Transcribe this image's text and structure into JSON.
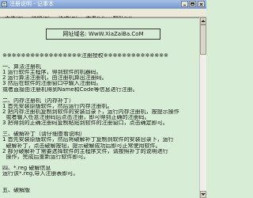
{
  "window": {
    "title": "注册说明 - 记事本",
    "app_icon": "notepad-icon",
    "controls": [
      "minimize-icon",
      "maximize-icon",
      "close-icon"
    ]
  },
  "menu": [
    "文件(F)",
    "编辑(E)",
    "格式(O)",
    "查看(V)",
    "帮助(H)"
  ],
  "document": {
    "banner": "网址域名: WwW.XiaZaiBa.CoM",
    "divider": "※※※※※※※※※※※※※※※※※注册授权※※※※※※※※※※※※※※",
    "sections": [
      {
        "heading": "一、算法注册机",
        "lines": [
          "1 运行软件主程序，得到软件的机器码。",
          "2 运行算法注册机，由注册机算出注册码。",
          "3 然后在软件的注册窗口中输入注册码。",
          "或者直接由注册机得到Name和Code等信息进行注册。"
        ]
      },
      {
        "heading": "二、内存注册机（内存补丁）",
        "lines": [
          "1 首先安装原版软件，然后运行内存注册机。",
          "2 把内存注册机复制到软件的安装目录下，运行内存注册机，按提示操作",
          "  或者输入任意注册码后点击注册，即可得到正确的注册码。",
          "3 把得到的正确注册码复制粘贴到软件的注册窗口，点击确定即可。"
        ]
      },
      {
        "heading": "三、破解补丁（请仔细查看说明）",
        "lines": [
          "1 首先安装原版软件，然后将破解补丁复制到软件的安装目录下，运行",
          "  破解补丁，点击破解按钮，提示破解成功后即可正常使用软件。",
          "2 部分破解补丁需要选择软件的主程序文件，请按照补丁的说明进行",
          "  操作，完成后重新运行软件即可。"
        ]
      },
      {
        "heading": "四、*.reg 破解信息",
        "lines": [
          "运行该*.reg,导入注册表即可。"
        ]
      },
      {
        "heading": "五、破解版",
        "lines": []
      }
    ]
  },
  "scrollbar": {
    "position": 0
  },
  "colors": {
    "title_bar": "#7596cc",
    "menu_bar": "#ece9d8",
    "editor_bg": "#d8edd6",
    "text": "#151515"
  }
}
